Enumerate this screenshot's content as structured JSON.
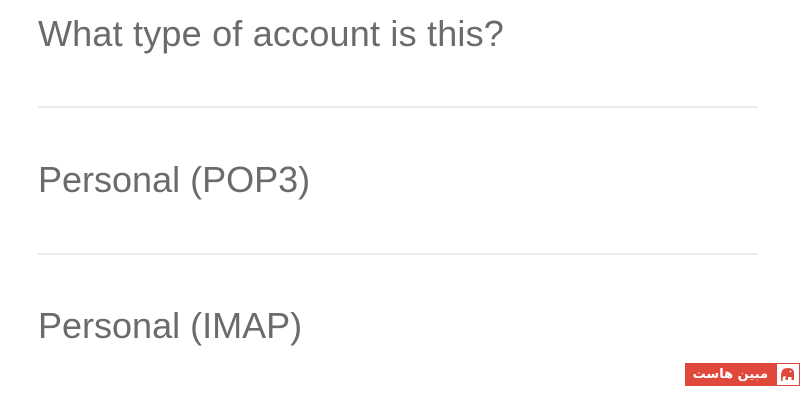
{
  "dialog": {
    "title": "What type of account is this?",
    "options": [
      {
        "label": "Personal (POP3)"
      },
      {
        "label": "Personal (IMAP)"
      }
    ]
  },
  "watermark": {
    "text": "مبین هاست",
    "icon": "elephant-logo-icon",
    "color": "#e0483b"
  },
  "colors": {
    "text": "#6b6b6b",
    "divider": "#ebebeb",
    "background": "#ffffff"
  }
}
